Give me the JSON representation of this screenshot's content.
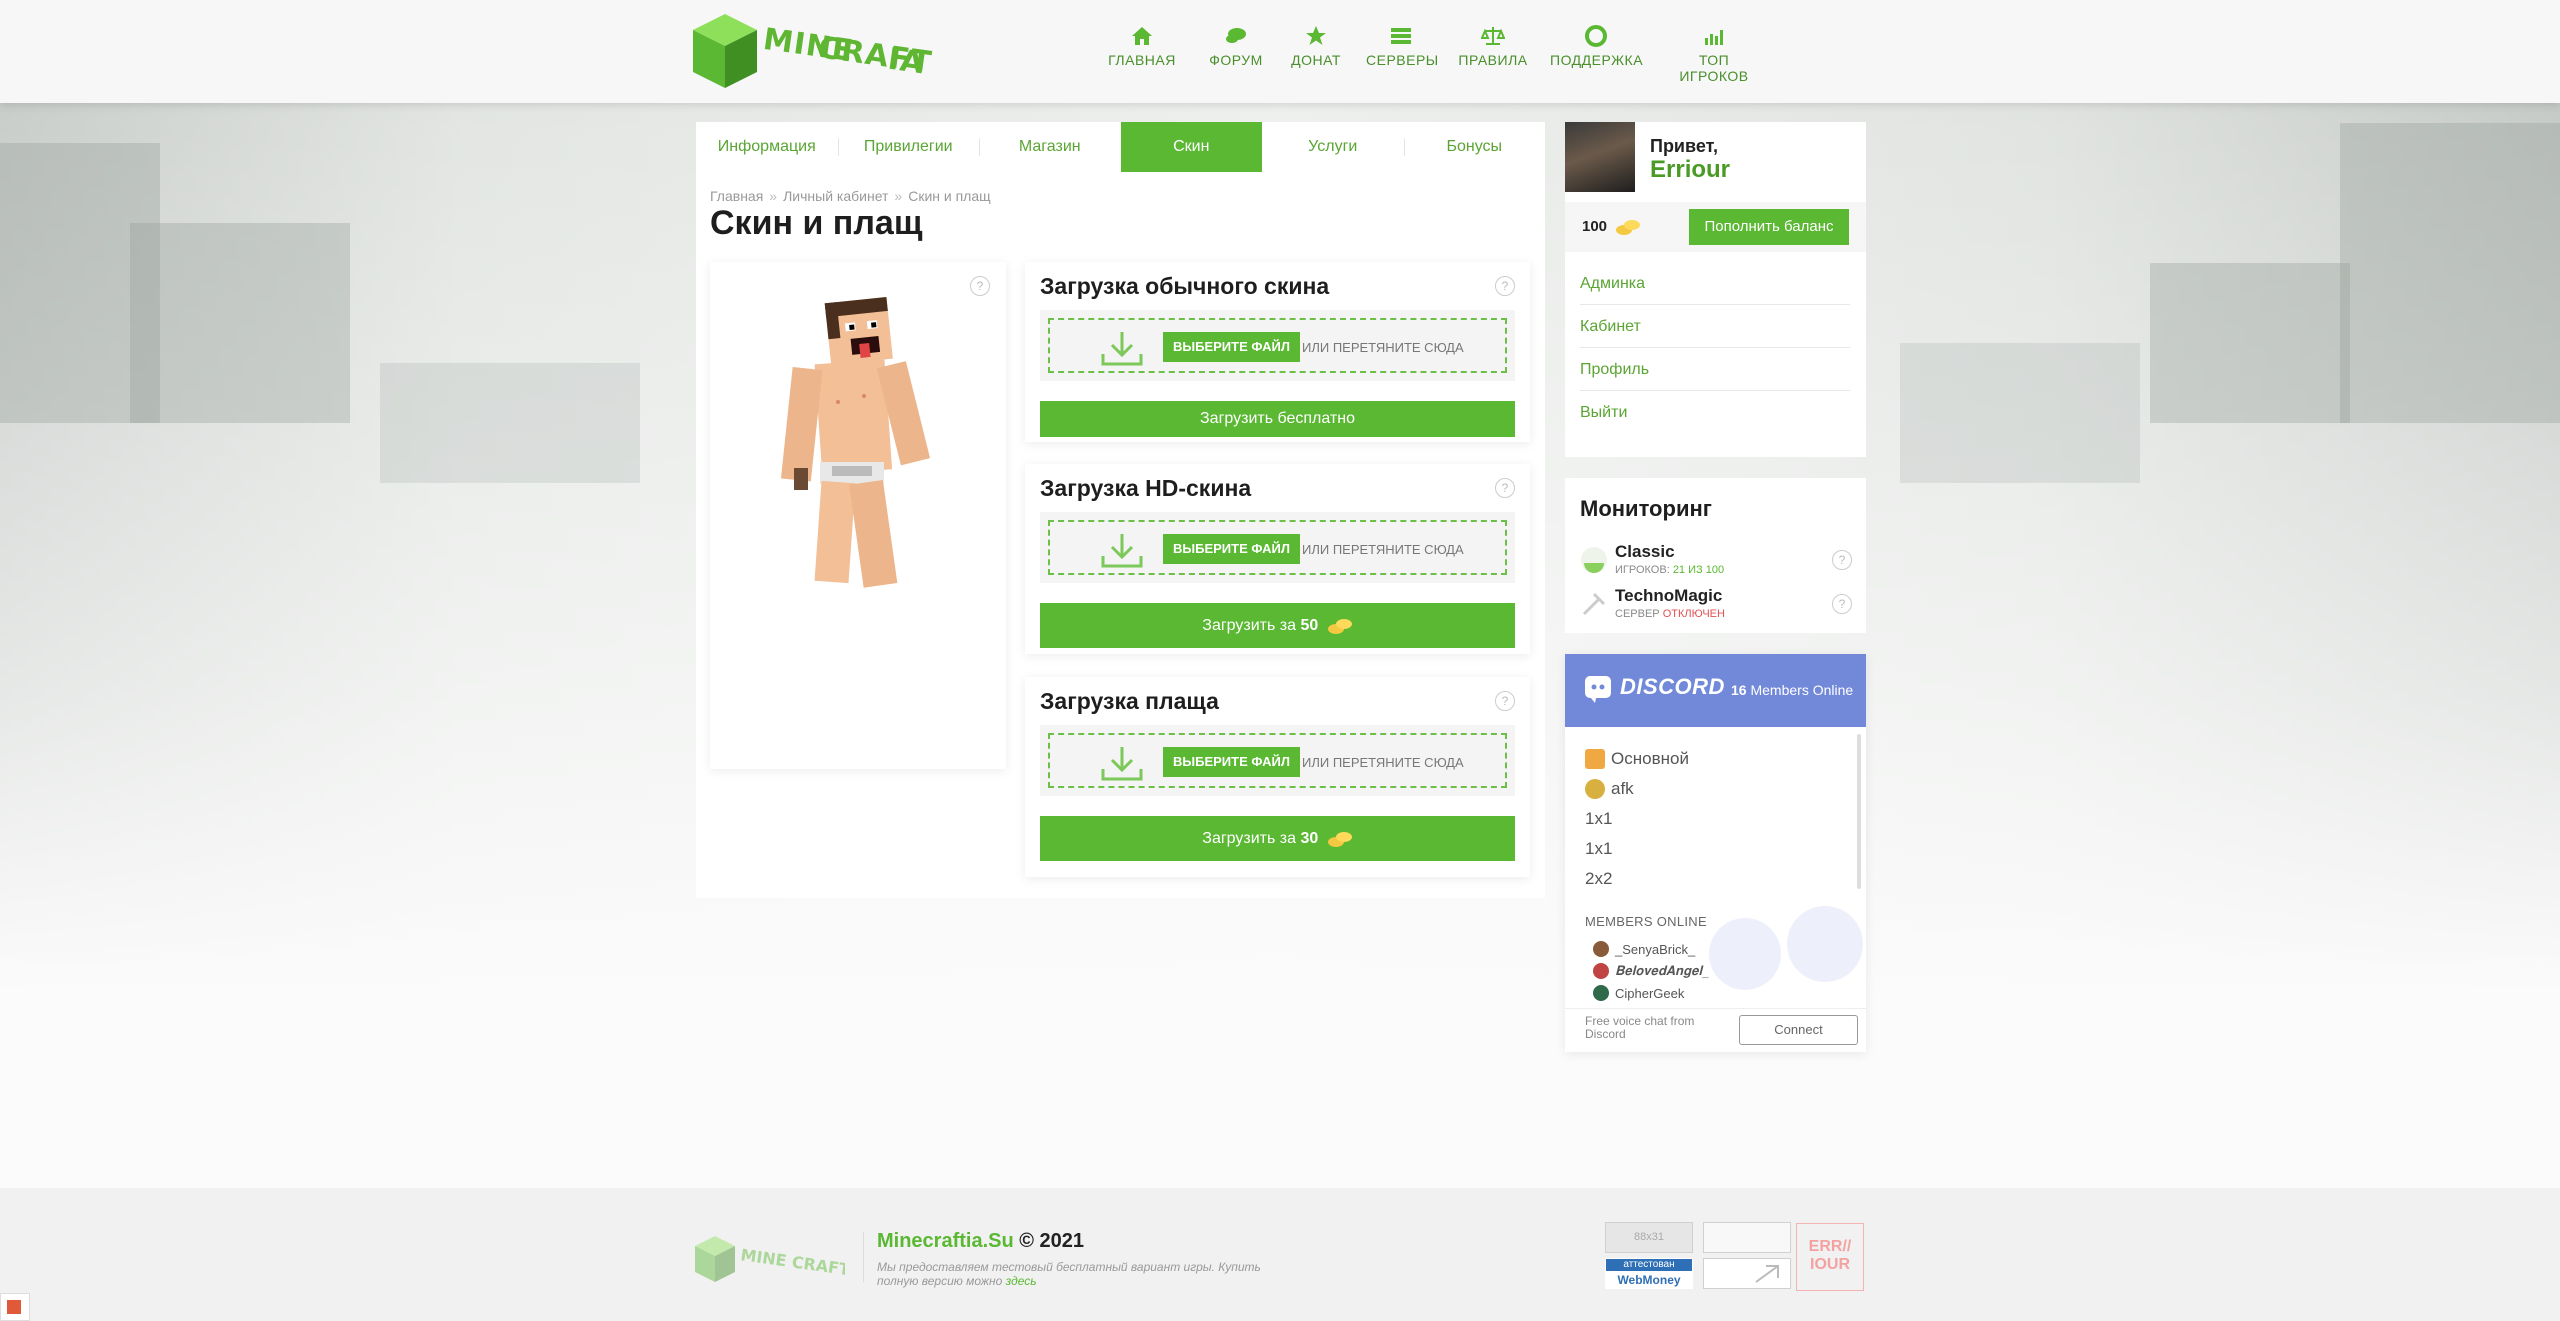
{
  "brand": {
    "logo_line1": "MINE",
    "logo_line2": "CRAFT",
    "logo_line3": "IA",
    "green": "#5ab832",
    "green_dark": "#4a9a26"
  },
  "nav": [
    {
      "label": "ГЛАВНАЯ",
      "icon": "home-icon"
    },
    {
      "label": "ФОРУМ",
      "icon": "chat-icon"
    },
    {
      "label": "ДОНАТ",
      "icon": "star-icon"
    },
    {
      "label": "СЕРВЕРЫ",
      "icon": "list-icon"
    },
    {
      "label": "ПРАВИЛА",
      "icon": "scales-icon"
    },
    {
      "label": "ПОДДЕРЖКА",
      "icon": "lifebuoy-icon"
    },
    {
      "label": "ТОП ИГРОКОВ",
      "icon": "chart-icon"
    }
  ],
  "tabs": [
    {
      "label": "Информация",
      "active": false
    },
    {
      "label": "Привилегии",
      "active": false
    },
    {
      "label": "Магазин",
      "active": false
    },
    {
      "label": "Скин",
      "active": true
    },
    {
      "label": "Услуги",
      "active": false
    },
    {
      "label": "Бонусы",
      "active": false
    }
  ],
  "breadcrumb": [
    "Главная",
    "Личный кабинет",
    "Скин и плащ"
  ],
  "breadcrumb_sep": "»",
  "page_title": "Скин и плащ",
  "help_mark": "?",
  "uploads": [
    {
      "title": "Загрузка обычного скина",
      "choose": "ВЫБЕРИТЕ ФАЙЛ",
      "or": "ИЛИ ПЕРЕТЯНИТЕ СЮДА",
      "button_text": "Загрузить бесплатно",
      "price": ""
    },
    {
      "title": "Загрузка HD-скина",
      "choose": "ВЫБЕРИТЕ ФАЙЛ",
      "or": "ИЛИ ПЕРЕТЯНИТЕ СЮДА",
      "button_text": "Загрузить за",
      "price": "50"
    },
    {
      "title": "Загрузка плаща",
      "choose": "ВЫБЕРИТЕ ФАЙЛ",
      "or": "ИЛИ ПЕРЕТЯНИТЕ СЮДА",
      "button_text": "Загрузить за",
      "price": "30"
    }
  ],
  "profile": {
    "greeting": "Привет,",
    "username": "Erriour",
    "balance": "100",
    "topup": "Пополнить баланс",
    "menu": [
      "Админка",
      "Кабинет",
      "Профиль",
      "Выйти"
    ]
  },
  "monitoring": {
    "title": "Мониторинг",
    "servers": [
      {
        "name": "Classic",
        "label": "ИГРОКОВ:",
        "status": "21 ИЗ 100",
        "online": true
      },
      {
        "name": "TechnoMagic",
        "label": "СЕРВЕР",
        "status": "ОТКЛЮЧЕН",
        "online": false
      }
    ]
  },
  "discord": {
    "logo": "DISCORD",
    "online_count": "16",
    "online_label": "Members Online",
    "channels": [
      "Основной",
      "afk",
      "1x1",
      "1x1",
      "2x2"
    ],
    "members_title": "MEMBERS ONLINE",
    "members": [
      "_SenyaBrick_",
      "𝐁𝐞𝐥𝐨𝐯𝐞𝐝𝐀𝐧𝐠𝐞𝐥_",
      "CipherGeek"
    ],
    "footer_text": "Free voice chat from Discord",
    "connect": "Connect",
    "color": "#7289da"
  },
  "footer": {
    "site": "Minecraftia.Su",
    "copyright": "© 2021",
    "desc": "Мы предоставляем тестовый бесплатный вариант игры. Купить полную версию можно",
    "link": "здесь",
    "badge_88": "88x31",
    "webmoney_top": "аттестован",
    "webmoney_bottom": "WebMoney",
    "err_badge_line1": "ERR//",
    "err_badge_line2": "IOUR"
  }
}
